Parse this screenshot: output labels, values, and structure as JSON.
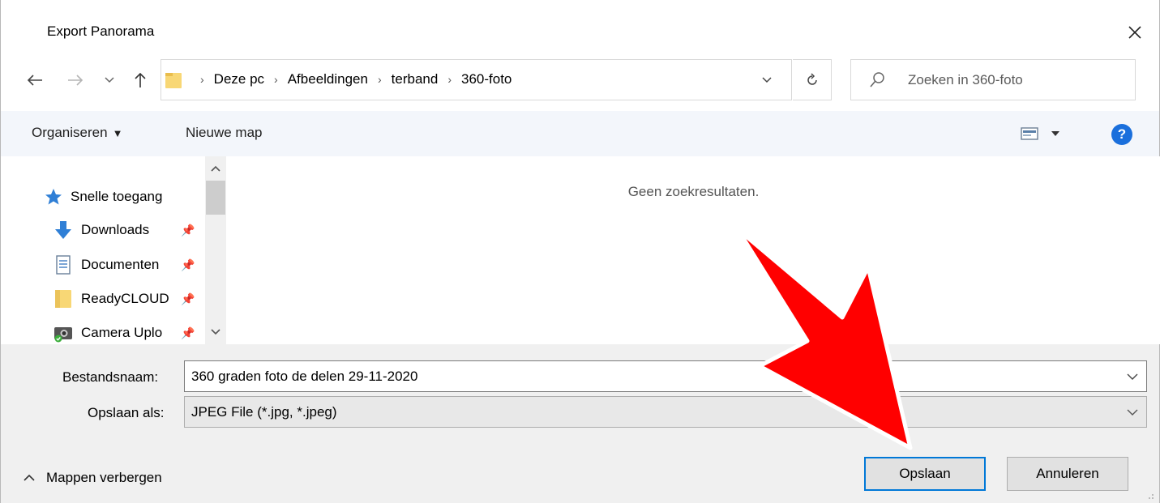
{
  "window": {
    "title": "Export Panorama"
  },
  "nav": {
    "breadcrumbs": [
      "Deze pc",
      "Afbeeldingen",
      "terband",
      "360-foto"
    ],
    "search_placeholder": "Zoeken in 360-foto"
  },
  "toolbar": {
    "organize_label": "Organiseren",
    "new_folder_label": "Nieuwe map",
    "help_label": "?"
  },
  "sidebar": {
    "items": [
      {
        "label": "Snelle toegang",
        "icon": "star-icon"
      },
      {
        "label": "Downloads",
        "icon": "download-arrow-icon"
      },
      {
        "label": "Documenten",
        "icon": "document-icon"
      },
      {
        "label": "ReadyCLOUD",
        "icon": "folder-icon"
      },
      {
        "label": "Camera Uplo",
        "icon": "camera-folder-icon"
      }
    ]
  },
  "main": {
    "empty_message": "Geen zoekresultaten."
  },
  "form": {
    "filename_label": "Bestandsnaam:",
    "filename_value": "360 graden foto de delen 29-11-2020",
    "savetype_label": "Opslaan als:",
    "savetype_value": "JPEG File (*.jpg, *.jpeg)"
  },
  "footer": {
    "hide_folders_label": "Mappen verbergen",
    "save_label": "Opslaan",
    "cancel_label": "Annuleren"
  },
  "colors": {
    "accent": "#0078d7",
    "toolbar_bg": "#f3f6fb",
    "annotation_arrow": "#ff0000"
  }
}
